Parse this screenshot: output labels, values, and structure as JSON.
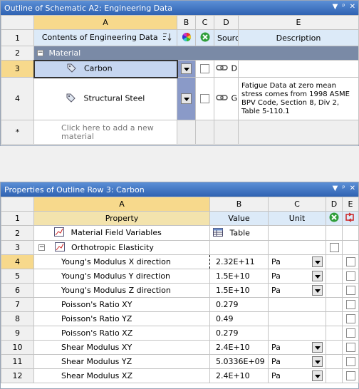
{
  "outline": {
    "title": "Outline of Schematic A2: Engineering Data",
    "controls": [
      "▼",
      "ᵖ",
      "✕"
    ],
    "col_letters": [
      "A",
      "B",
      "C",
      "D",
      "E"
    ],
    "rows": [
      {
        "num": "1",
        "a": "Contents of Engineering Data",
        "d": "Source",
        "e": "Description"
      },
      {
        "num": "2",
        "a": "Material"
      },
      {
        "num": "3",
        "a": "Carbon",
        "d": "D"
      },
      {
        "num": "4",
        "a": "Structural Steel",
        "d": "G",
        "e_lines": [
          "Fatigue Data at zero mean",
          "stress comes from 1998 ASME",
          "BPV Code, Section 8, Div 2,",
          "Table 5-110.1"
        ]
      },
      {
        "num": "*",
        "a_lines": [
          "Click here to add a new",
          "material"
        ]
      }
    ]
  },
  "properties": {
    "title": "Properties of Outline Row 3: Carbon",
    "controls": [
      "▼",
      "ᵖ",
      "✕"
    ],
    "col_letters": [
      "A",
      "B",
      "C",
      "D",
      "E"
    ],
    "header": {
      "num": "1",
      "property": "Property",
      "value": "Value",
      "unit": "Unit"
    },
    "rows": [
      {
        "num": "2",
        "property": "Material Field Variables",
        "value": "Table",
        "unit": ""
      },
      {
        "num": "3",
        "property": "Orthotropic Elasticity",
        "value": "",
        "unit": ""
      },
      {
        "num": "4",
        "property": "Young's Modulus X direction",
        "value": "2.32E+11",
        "unit": "Pa"
      },
      {
        "num": "5",
        "property": "Young's Modulus Y direction",
        "value": "1.5E+10",
        "unit": "Pa"
      },
      {
        "num": "6",
        "property": "Young's Modulus Z direction",
        "value": "1.5E+10",
        "unit": "Pa"
      },
      {
        "num": "7",
        "property": "Poisson's Ratio XY",
        "value": "0.279",
        "unit": ""
      },
      {
        "num": "8",
        "property": "Poisson's Ratio YZ",
        "value": "0.49",
        "unit": ""
      },
      {
        "num": "9",
        "property": "Poisson's Ratio XZ",
        "value": "0.279",
        "unit": ""
      },
      {
        "num": "10",
        "property": "Shear Modulus XY",
        "value": "2.4E+10",
        "unit": "Pa"
      },
      {
        "num": "11",
        "property": "Shear Modulus YZ",
        "value": "5.0336E+09",
        "unit": "Pa"
      },
      {
        "num": "12",
        "property": "Shear Modulus XZ",
        "value": "2.4E+10",
        "unit": "Pa"
      }
    ]
  },
  "colors": {
    "title_bar": "#2f62b2",
    "selected_header": "#f7d98c",
    "group_row": "#7a8aa6"
  }
}
